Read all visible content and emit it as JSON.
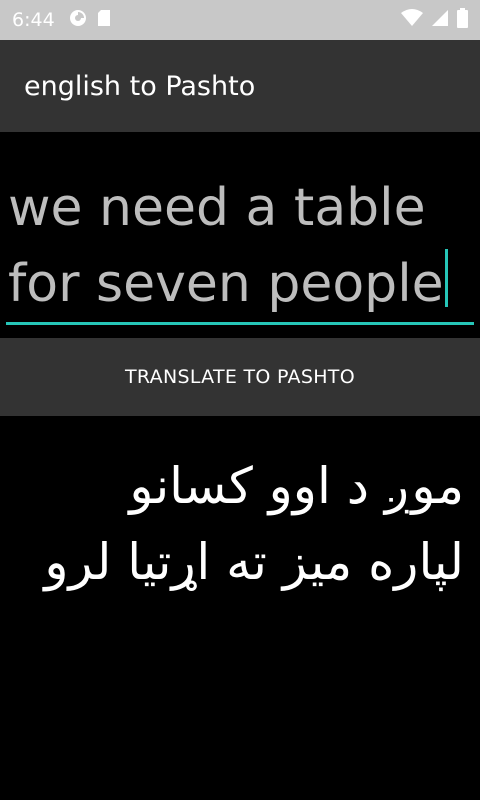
{
  "status_bar": {
    "time": "6:44",
    "icons": [
      "sync-icon",
      "sd-card-icon",
      "wifi-icon",
      "cellular-signal-icon",
      "battery-icon"
    ]
  },
  "app_bar": {
    "title": "english to Pashto"
  },
  "input": {
    "value": "we need a table\nfor seven people",
    "accent_color": "#26c6b8"
  },
  "translate_button": {
    "label": "TRANSLATE TO PASHTO"
  },
  "output": {
    "text": "موږ د اوو کسانو\nلپاره میز ته اړتیا لرو"
  },
  "colors": {
    "background": "#000000",
    "app_bar": "#333333",
    "status_bar": "#c8c8c8",
    "accent": "#26c6b8"
  }
}
